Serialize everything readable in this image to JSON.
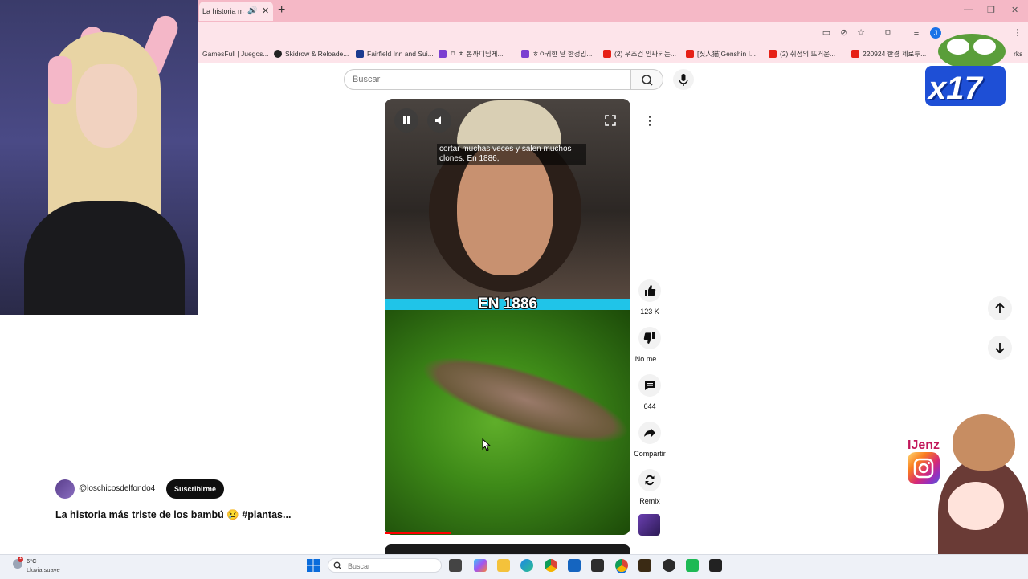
{
  "browser": {
    "tab": {
      "title": "La historia más triste de"
    },
    "bookmarks": [
      {
        "label": "GamesFull | Juegos...",
        "color": "#2c6fd1"
      },
      {
        "label": "Skidrow & Reloade...",
        "color": "#222222"
      },
      {
        "label": "Fairfield Inn and Sui...",
        "color": "#1b3a8f"
      },
      {
        "label": "ㅁ ㅊ 통까디님게...",
        "color": "#7b3fd1"
      },
      {
        "label": "ㅎㅇ귀한 날 한겅입...",
        "color": "#7b3fd1"
      },
      {
        "label": "(2) 우즈건 인싸되는...",
        "color": "#e62117"
      },
      {
        "label": "[짓人猫]Genshin I...",
        "color": "#e62117"
      },
      {
        "label": "(2) 취정의 뜨거운...",
        "color": "#e62117"
      },
      {
        "label": "220924 한경 제로투...",
        "color": "#e62117"
      }
    ],
    "bookmarks_tail": "rks",
    "profile_initial": "J"
  },
  "youtube": {
    "search": {
      "placeholder": "Buscar"
    },
    "video": {
      "caption_top": "cortar muchas veces y salen muchos clones. En 1886,",
      "caption_big": "EN 1886",
      "progress": 0.27
    },
    "actions": [
      {
        "icon": "thumbs-up-icon",
        "label": "123 K"
      },
      {
        "icon": "thumbs-down-icon",
        "label": "No me ..."
      },
      {
        "icon": "comment-icon",
        "label": "644"
      },
      {
        "icon": "share-icon",
        "label": "Compartir"
      },
      {
        "icon": "remix-icon",
        "label": "Remix"
      }
    ],
    "channel": {
      "handle": "@loschicosdelfondo4",
      "subscribe_label": "Suscribirme"
    },
    "title": "La historia más triste de los bambú 😢 #plantas..."
  },
  "overlays": {
    "pepe_text": "x17",
    "instagram_name": "IJenz"
  },
  "taskbar": {
    "weather_temp": "6°C",
    "weather_desc": "Lluvia suave",
    "weather_badge": "1",
    "search_placeholder": "Buscar",
    "apps": [
      "file-icon",
      "copilot-icon",
      "folder-icon",
      "edge-icon",
      "chrome-icon",
      "store-icon",
      "xbox-icon",
      "chrome-active-icon",
      "game-icon",
      "obs-icon",
      "spotify-icon",
      "epic-icon"
    ]
  }
}
